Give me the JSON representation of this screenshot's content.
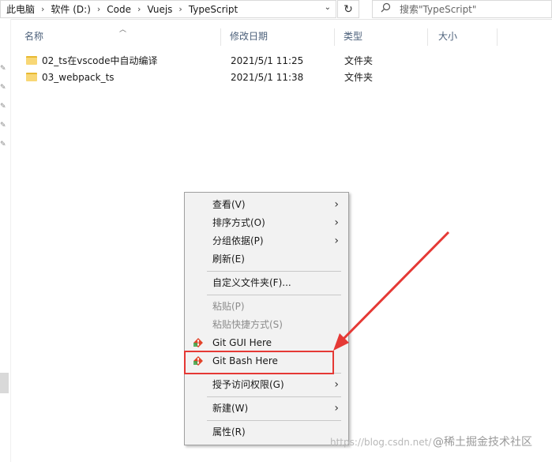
{
  "address": {
    "crumbs": [
      "此电脑",
      "软件 (D:)",
      "Code",
      "Vuejs",
      "TypeScript"
    ],
    "search_placeholder": "搜索\"TypeScript\""
  },
  "columns": {
    "name": "名称",
    "modified": "修改日期",
    "type": "类型",
    "size": "大小"
  },
  "files": [
    {
      "name": "02_ts在vscode中自动编译",
      "modified": "2021/5/1 11:25",
      "type": "文件夹"
    },
    {
      "name": "03_webpack_ts",
      "modified": "2021/5/1 11:38",
      "type": "文件夹"
    }
  ],
  "context_menu": {
    "view": "查看(V)",
    "sort": "排序方式(O)",
    "group": "分组依据(P)",
    "refresh": "刷新(E)",
    "customize": "自定义文件夹(F)...",
    "paste": "粘贴(P)",
    "paste_shortcut": "粘贴快捷方式(S)",
    "git_gui": "Git GUI Here",
    "git_bash": "Git Bash Here",
    "grant_access": "授予访问权限(G)",
    "new": "新建(W)",
    "properties": "属性(R)"
  },
  "watermark": {
    "url": "https://blog.csdn.net/",
    "brand": "@稀土掘金技术社区"
  },
  "colors": {
    "highlight_red": "#e53935",
    "folder_yellow": "#f8d775"
  }
}
